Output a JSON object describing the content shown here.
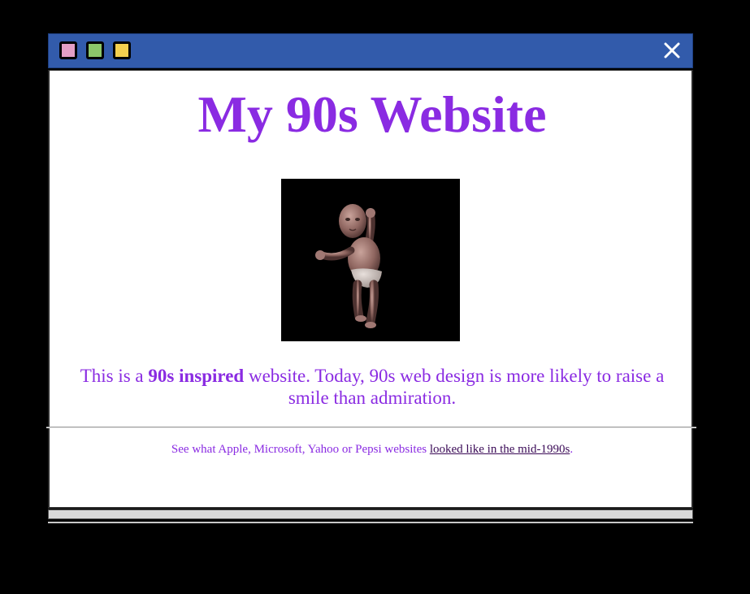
{
  "window": {
    "buttons": [
      {
        "name": "pink",
        "color": "#e39fc6"
      },
      {
        "name": "green",
        "color": "#8cc66a"
      },
      {
        "name": "yellow",
        "color": "#f3d04f"
      }
    ],
    "titlebar_color": "#325bab",
    "close_icon": "close-icon"
  },
  "page": {
    "title": "My 90s Website",
    "title_color": "#8a2be2",
    "image": "dancing-baby-image",
    "intro_before": "This is a ",
    "intro_bold": "90s inspired",
    "intro_after": " website. Today, 90s web design is more likely to raise a smile than admiration.",
    "footer_before": "See what Apple, Microsoft, Yahoo or Pepsi websites ",
    "footer_link": "looked like in the mid-1990s",
    "footer_after": "."
  }
}
